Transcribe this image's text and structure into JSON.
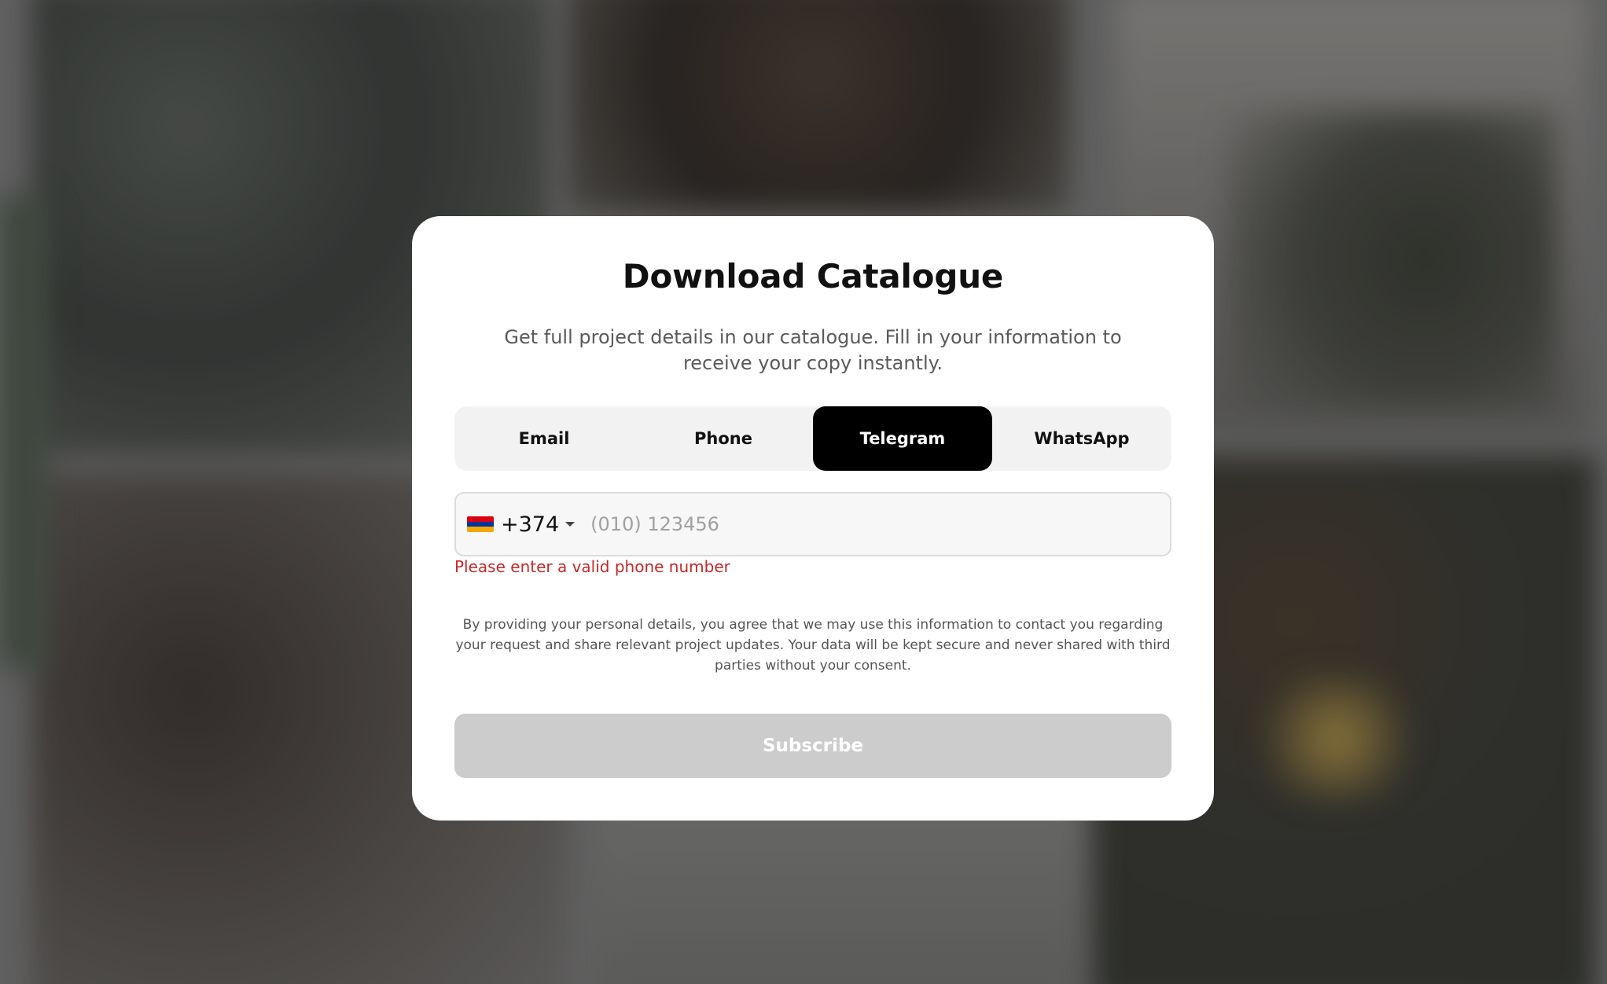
{
  "modal": {
    "title": "Download Catalogue",
    "subtitle": "Get full project details in our catalogue. Fill in your information to receive your copy instantly."
  },
  "tabs": [
    {
      "label": "Email",
      "active": false
    },
    {
      "label": "Phone",
      "active": false
    },
    {
      "label": "Telegram",
      "active": true
    },
    {
      "label": "WhatsApp",
      "active": false
    }
  ],
  "phone": {
    "country_flag": "armenia-flag",
    "dial_code": "+374",
    "value": "",
    "placeholder": "(010) 123456",
    "error": "Please enter a valid phone number"
  },
  "consent_text": "By providing your personal details, you agree that we may use this information to contact you regarding your request and share relevant project updates. Your data will be kept secure and never shared with third parties without your consent.",
  "subscribe_label": "Subscribe",
  "colors": {
    "active_tab": "#000000",
    "error": "#c62828",
    "subscribe_disabled": "#cccccc",
    "flag_red": "#d90012",
    "flag_blue": "#0033a0",
    "flag_orange": "#f2a800"
  }
}
